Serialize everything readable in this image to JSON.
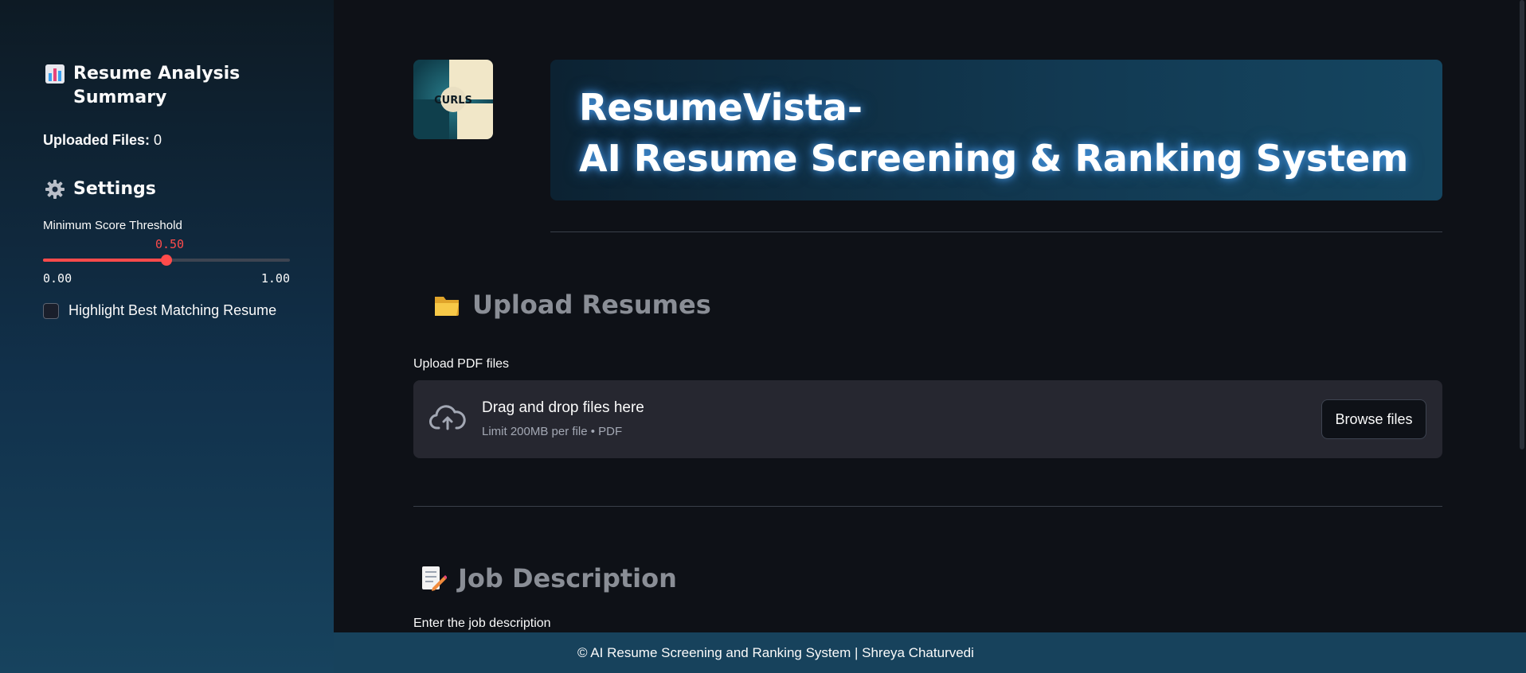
{
  "sidebar": {
    "summary_title": "Resume Analysis Summary",
    "uploaded_label": "Uploaded Files:",
    "uploaded_count": "0",
    "settings_title": "Settings",
    "threshold": {
      "label": "Minimum Score Threshold",
      "value": 0.5,
      "value_display": "0.50",
      "min_display": "0.00",
      "max_display": "1.00"
    },
    "highlight_checkbox": {
      "label": "Highlight Best Matching Resume",
      "checked": false
    }
  },
  "header": {
    "logo_text": "CURLS",
    "title_line1": "ResumeVista-",
    "title_line2": "AI Resume Screening & Ranking System"
  },
  "upload": {
    "section_title": "Upload Resumes",
    "field_label": "Upload PDF files",
    "dropzone_title": "Drag and drop files here",
    "dropzone_subtitle": "Limit 200MB per file • PDF",
    "browse_label": "Browse files"
  },
  "job": {
    "section_title": "Job Description",
    "field_label": "Enter the job description"
  },
  "footer": {
    "text": "© AI Resume Screening and Ranking System | Shreya Chaturvedi"
  },
  "colors": {
    "accent": "#ff4b4b",
    "background": "#0e1117",
    "dropzone_bg": "#262730",
    "footer_bg": "#17425c"
  },
  "icons": {
    "summary": "bar-chart-icon",
    "settings": "gear-icon",
    "upload": "folder-icon",
    "job": "memo-icon",
    "dropzone": "cloud-upload-icon"
  }
}
